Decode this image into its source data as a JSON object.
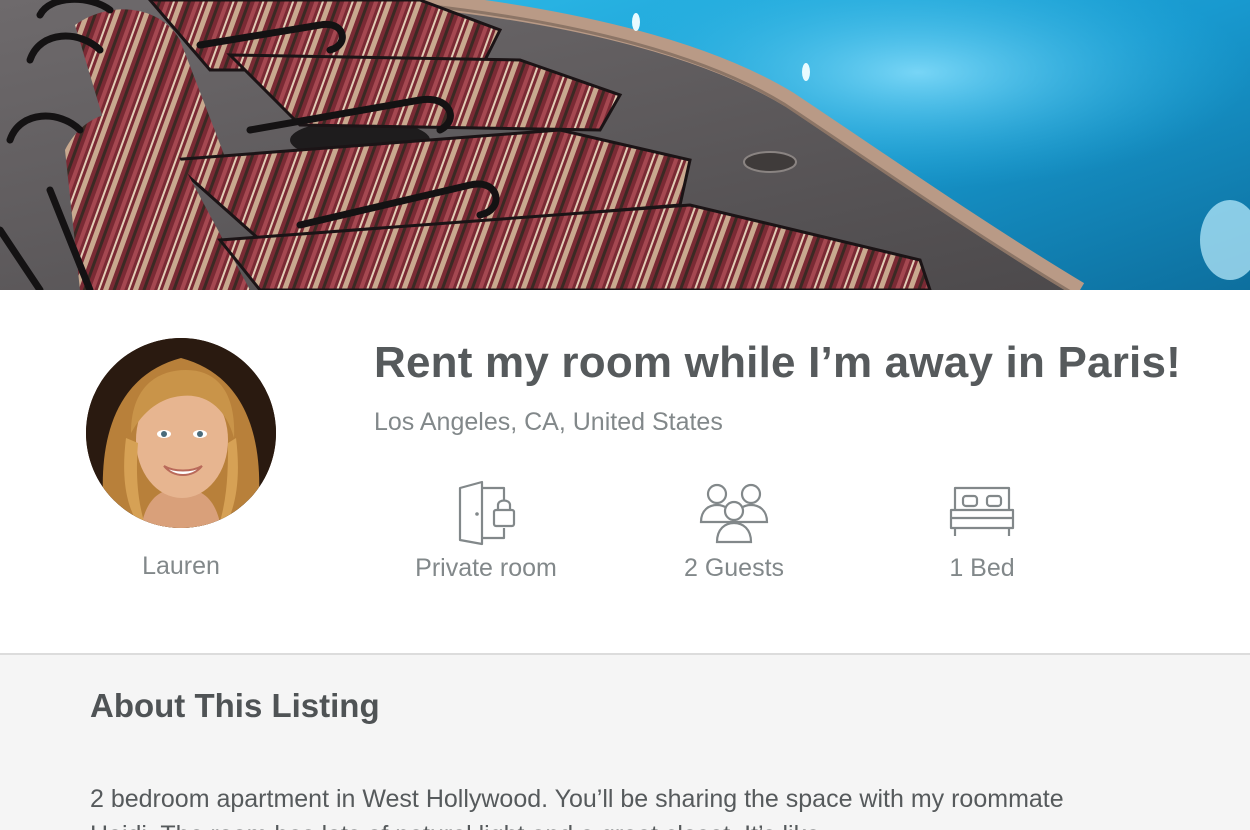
{
  "listing": {
    "title": "Rent my room while I’m away in Paris!",
    "location": "Los Angeles, CA, United States"
  },
  "host": {
    "name": "Lauren"
  },
  "amenities": [
    {
      "icon": "door-lock-icon",
      "label": "Private room"
    },
    {
      "icon": "guests-icon",
      "label": "2 Guests"
    },
    {
      "icon": "bed-icon",
      "label": "1 Bed"
    }
  ],
  "about": {
    "heading": "About This Listing",
    "description": "2 bedroom apartment in West Hollywood. You’ll be sharing the space with my roommate Heidi. The room has lots of natural light and a great closet. It’s like"
  },
  "colors": {
    "pool": "#1fa4d6",
    "text_dark": "#565a5c",
    "text_muted": "#82888a",
    "about_bg": "#f5f5f5"
  }
}
